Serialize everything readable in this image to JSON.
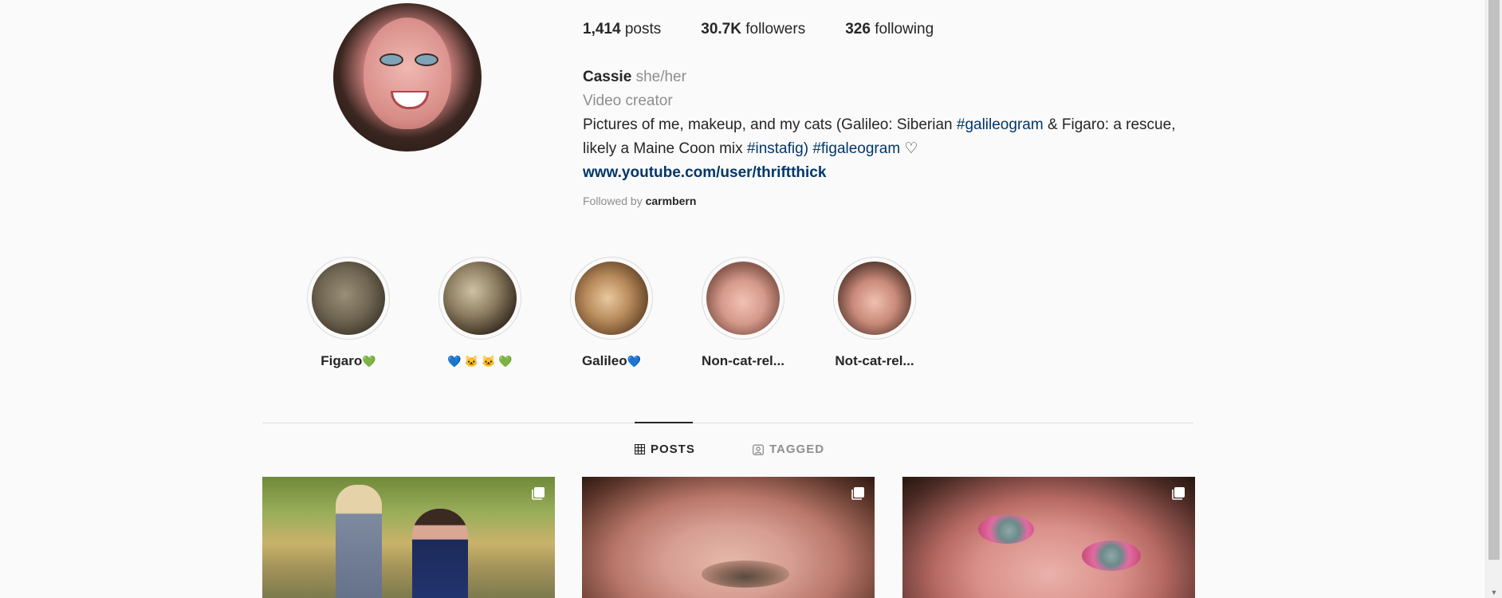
{
  "profile": {
    "stats": {
      "posts_count": "1,414",
      "posts_label": "posts",
      "followers_count": "30.7K",
      "followers_label": "followers",
      "following_count": "326",
      "following_label": "following"
    },
    "name": "Cassie",
    "pronouns": "she/her",
    "category": "Video creator",
    "bio": {
      "part1": "Pictures of me, makeup, and my cats (Galileo: Siberian ",
      "tag1": "#galileogram",
      "part2": " & Figaro: a rescue, likely a Maine Coon mix ",
      "tag2": "#instafig)",
      "part3": " ",
      "tag3": "#figaleogram",
      "part4": " ♡"
    },
    "link": "www.youtube.com/user/thriftthick",
    "followed_by_prefix": "Followed by ",
    "followed_by_user": "carmbern"
  },
  "highlights": [
    {
      "text": "Figaro",
      "emoji": "💚"
    },
    {
      "text": "",
      "emoji": "💙 🐱 🐱 💚"
    },
    {
      "text": "Galileo",
      "emoji": "💙"
    },
    {
      "text": "Non-cat-rel...",
      "emoji": ""
    },
    {
      "text": "Not-cat-rel...",
      "emoji": ""
    }
  ],
  "tabs": {
    "posts": "POSTS",
    "tagged": "TAGGED"
  },
  "colors": {
    "background": "#fafafa",
    "text": "#262626",
    "muted": "#8e8e8e",
    "link": "#00376b",
    "divider": "#dbdbdb"
  }
}
